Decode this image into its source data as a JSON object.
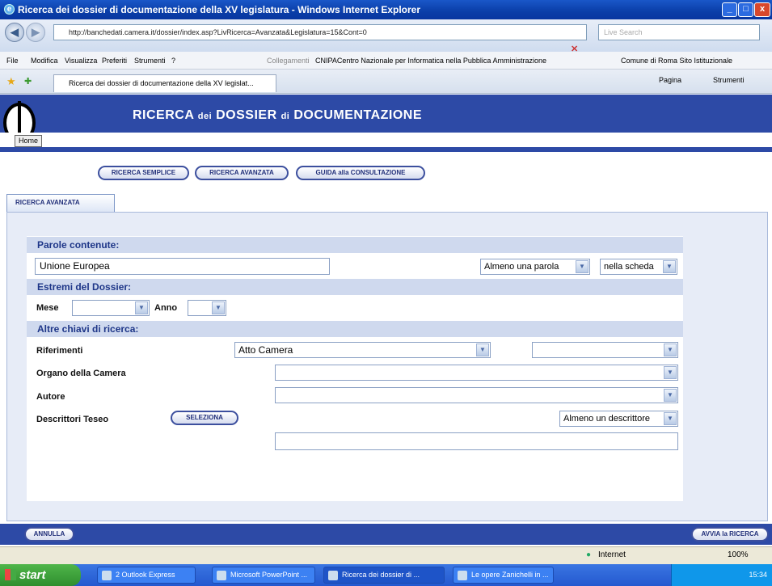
{
  "window": {
    "title": "Ricerca dei dossier di documentazione della XV legislatura - Windows Internet Explorer",
    "min": "_",
    "max": "□",
    "close": "x"
  },
  "address": {
    "url": "http://banchedati.camera.it/dossier/index.asp?LivRicerca=Avanzata&Legislatura=15&Cont=0",
    "search_placeholder": "Live Search"
  },
  "menu": {
    "items": [
      "File",
      "Modifica",
      "Visualizza",
      "Preferiti",
      "Strumenti",
      "?"
    ],
    "links_label": "Collegamenti",
    "links": [
      "CNIPACentro Nazionale per Informatica nella Pubblica Amministrazione",
      "Comune di Roma Sito Istituzionale"
    ]
  },
  "browser_tab": {
    "title": "Ricerca dei dossier di documentazione della XV legislat...",
    "tools": [
      "Pagina",
      "Strumenti"
    ]
  },
  "header": {
    "title_a": "RICERCA",
    "title_b": "dei",
    "title_c": "DOSSIER",
    "title_d": "di",
    "title_e": "DOCUMENTAZIONE",
    "home": "Home"
  },
  "nav_buttons": [
    "RICERCA SEMPLICE",
    "RICERCA AVANZATA",
    "GUIDA alla CONSULTAZIONE"
  ],
  "section_tab": "RICERCA AVANZATA",
  "form": {
    "parole_header": "Parole contenute:",
    "parole_value": "Unione Europea",
    "parole_mode": "Almeno una parola",
    "parole_scope": "nella scheda",
    "estremi_header": "Estremi del Dossier:",
    "mese_label": "Mese",
    "anno_label": "Anno",
    "altre_header": "Altre chiavi di ricerca:",
    "riferimenti_label": "Riferimenti",
    "riferimenti_value": "Atto Camera",
    "organo_label": "Organo della Camera",
    "autore_label": "Autore",
    "descrittori_label": "Descrittori Teseo",
    "seleziona": "SELEZIONA",
    "descrittori_mode": "Almeno un descrittore"
  },
  "actions": {
    "annulla": "ANNULLA",
    "avvia": "AVVIA la RICERCA"
  },
  "status": {
    "zone": "Internet",
    "zoom": "100%"
  },
  "taskbar": {
    "start": "start",
    "tasks": [
      "2 Outlook Express",
      "Microsoft PowerPoint ...",
      "Ricerca dei dossier di ...",
      "Le opere Zanichelli in ..."
    ],
    "clock": "15:34"
  }
}
